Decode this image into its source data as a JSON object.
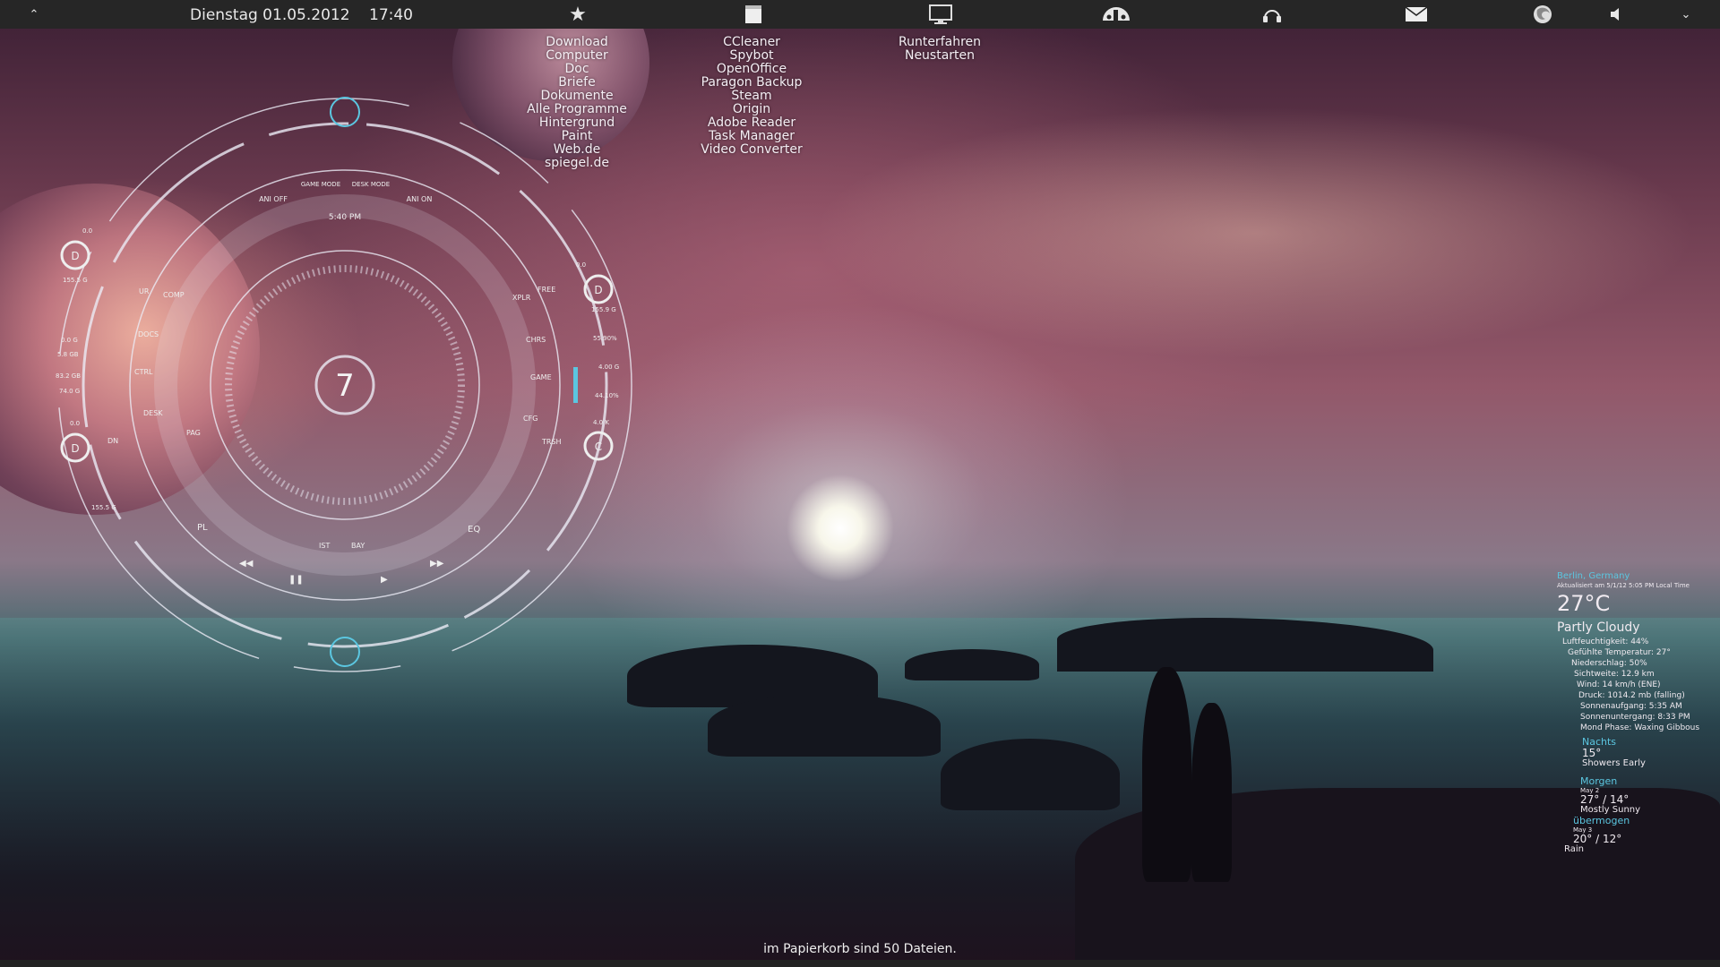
{
  "taskbar": {
    "date": "Dienstag 01.05.2012",
    "time": "17:40",
    "icons": [
      "collapse-icon",
      "star-icon",
      "notepad-icon",
      "monitor-icon",
      "deviantart-icon",
      "headphones-icon",
      "mail-icon",
      "firefox-icon",
      "speaker-icon",
      "chevron-down-icon"
    ]
  },
  "launcher": {
    "column1": [
      "Download",
      "Computer",
      "Doc",
      "Briefe",
      "Dokumente",
      "Alle Programme",
      "Hintergrund",
      "Paint",
      "Web.de",
      "spiegel.de"
    ],
    "column2": [
      "CCleaner",
      "Spybot",
      "OpenOffice",
      "Paragon Backup",
      "Steam",
      "Origin",
      "Adobe Reader",
      "Task Manager",
      "Video Converter"
    ],
    "column3": [
      "Runterfahren",
      "Neustarten"
    ]
  },
  "hud": {
    "center_value": "7",
    "time": "5:40 PM",
    "top_buttons": [
      "ANI OFF",
      "GAME MODE",
      "DESK MODE",
      "ANI ON"
    ],
    "left_buttons": [
      "UR",
      "COMP",
      "DOCS",
      "CTRL",
      "DESK",
      "PAG",
      "DN"
    ],
    "right_buttons": [
      "FREE",
      "XPLR",
      "CHRS",
      "GAME",
      "CFG",
      "TRSH"
    ],
    "bottom_labels": [
      "PL",
      "IST",
      "BAY",
      "EQ"
    ],
    "drives": [
      {
        "letter": "D",
        "top": "0.0",
        "bottom": "155.5 G"
      },
      {
        "letter": "D",
        "top": "0.0",
        "bottom": "155.5 G"
      },
      {
        "letter": "D",
        "top": "0.0",
        "bottom": "155.9 G"
      },
      {
        "letter": "C",
        "top": "4.0 K",
        "bottom": ""
      }
    ],
    "left_stats": [
      "0.0 G",
      "5.8 GB",
      "83.2 GB",
      "74.0 G"
    ],
    "right_stats": [
      "55.90%",
      "4.00 G",
      "44.10%"
    ]
  },
  "weather": {
    "location": "Berlin, Germany",
    "updated": "Aktualisiert am 5/1/12 5:05 PM Local Time",
    "temp": "27°C",
    "condition": "Partly Cloudy",
    "details": [
      "Luftfeuchtigkeit: 44%",
      "Gefühlte Temperatur: 27°",
      "Niederschlag: 50%",
      "Sichtweite: 12.9 km",
      "Wind: 14 km/h (ENE)",
      "Druck: 1014.2 mb (falling)",
      "Sonnenaufgang: 5:35 AM",
      "Sonnenuntergang:  8:33 PM",
      "Mond Phase: Waxing Gibbous"
    ],
    "night_label": "Nachts",
    "night_temp": "15°",
    "night_cond": "Showers Early",
    "tomorrow_label": "Morgen",
    "tomorrow_date": "May 2",
    "tomorrow_temp": "27° / 14°",
    "tomorrow_cond": "Mostly Sunny",
    "after_label": "übermogen",
    "after_date": "May 3",
    "after_temp": "20° / 12°",
    "after_cond": "Rain"
  },
  "trash_message": "im Papierkorb sind 50 Dateien.",
  "colors": {
    "accent": "#5bc6e0",
    "bar": "#262626"
  }
}
